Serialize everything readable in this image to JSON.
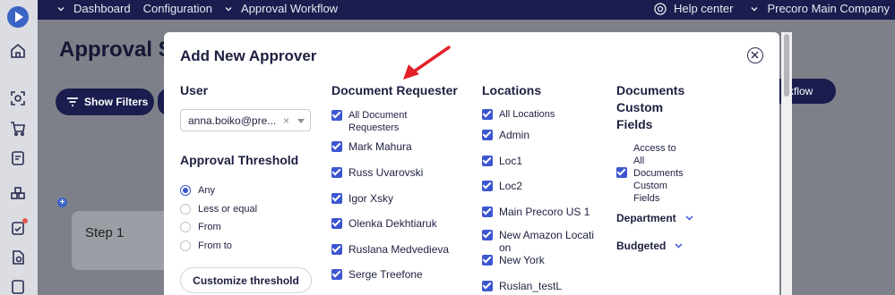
{
  "topbar": {
    "nav": [
      "Dashboard",
      "Configuration",
      "Approval Workflow"
    ],
    "help_label": "Help center",
    "company_label": "Precoro Main Company"
  },
  "background": {
    "page_title": "Approval S",
    "show_filters_label": "Show Filters",
    "workflow_label": "rkflow",
    "step_label": "Step 1",
    "plus": "+"
  },
  "modal": {
    "title": "Add New Approver",
    "user": {
      "heading": "User",
      "selected_value": "anna.boiko@pre...",
      "clear": "×"
    },
    "threshold": {
      "heading": "Approval Threshold",
      "options": [
        "Any",
        "Less or equal",
        "From",
        "From to"
      ],
      "selected": "Any",
      "customize_label": "Customize threshold"
    },
    "requester": {
      "heading": "Document Requester",
      "items": [
        "All Document Requesters",
        "Mark Mahura",
        "Russ Uvarovski",
        "Igor Xsky",
        "Olenka Dekhtiaruk",
        "Ruslana Medvedieva",
        "Serge Treefone"
      ]
    },
    "locations": {
      "heading": "Locations",
      "items": [
        "All Locations",
        "Admin",
        "Loc1",
        "Loc2",
        "Main Precoro US 1",
        "New Amazon Location",
        "New York",
        "Ruslan_testL"
      ]
    },
    "custom_fields": {
      "heading": "Documents Custom Fields",
      "access_label": "Access to All Documents Custom Fields",
      "department_label": "Department",
      "budgeted_label": "Budgeted"
    }
  },
  "colors": {
    "navy": "#1a1d4e",
    "accent_blue": "#3c56d0",
    "annotation_red": "#e3202a",
    "overlay": "#7e8089"
  }
}
